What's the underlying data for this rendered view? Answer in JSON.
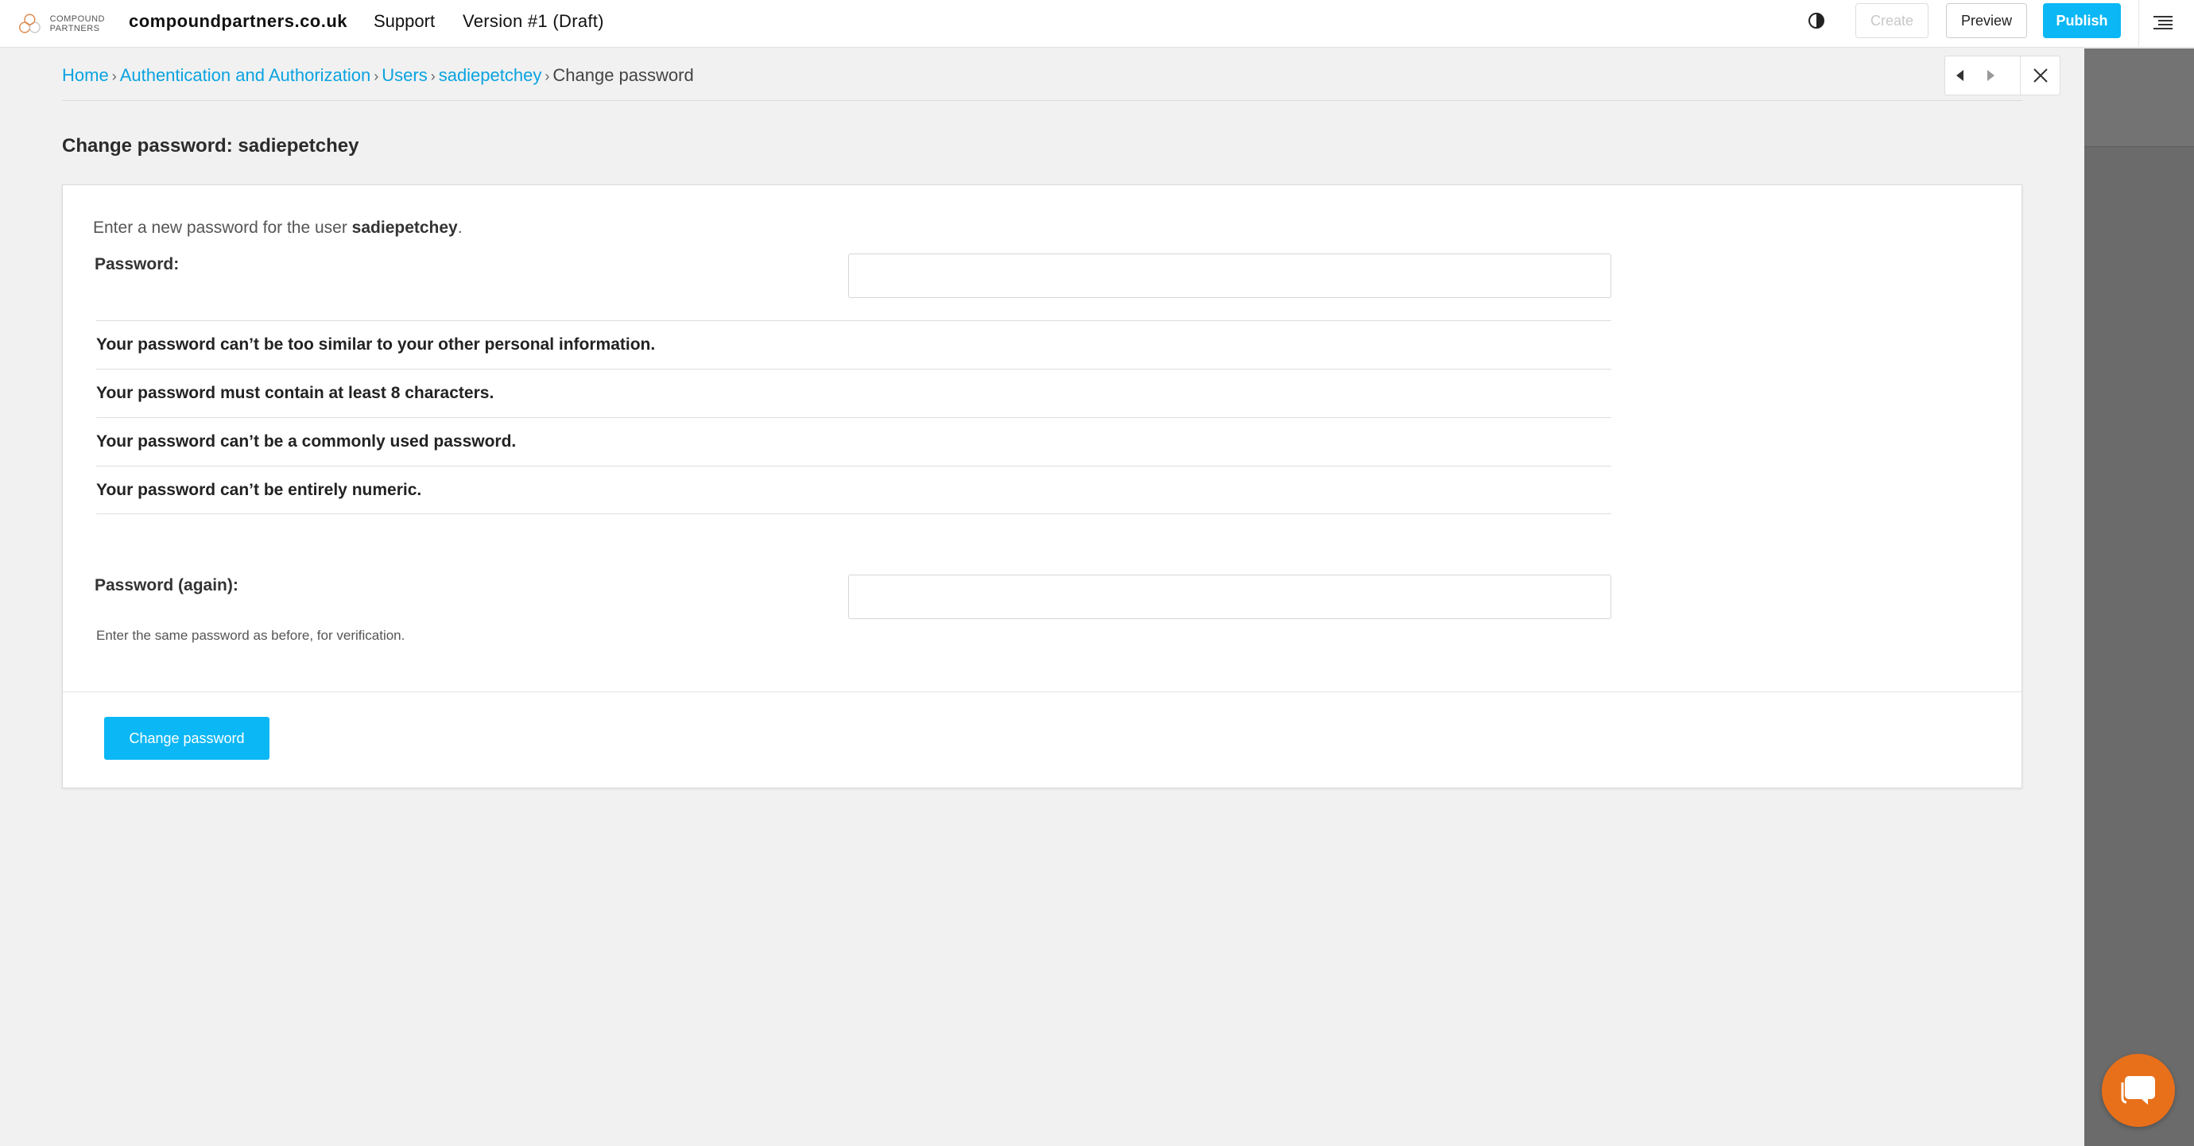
{
  "topbar": {
    "logo_line1": "COMPOUND",
    "logo_line2": "PARTNERS",
    "site_name": "compoundpartners.co.uk",
    "support_label": "Support",
    "version_label": "Version #1 (Draft)",
    "create_label": "Create",
    "preview_label": "Preview",
    "publish_label": "Publish"
  },
  "breadcrumb": {
    "items": [
      "Home",
      "Authentication and Authorization",
      "Users",
      "sadiepetchey"
    ],
    "current": "Change password",
    "separator": "›"
  },
  "page": {
    "title": "Change password: sadiepetchey"
  },
  "form": {
    "intro_prefix": "Enter a new password for the user ",
    "intro_user": "sadiepetchey",
    "intro_suffix": ".",
    "password_label": "Password:",
    "password_value": "",
    "rules": [
      "Your password can’t be too similar to your other personal information.",
      "Your password must contain at least 8 characters.",
      "Your password can’t be a commonly used password.",
      "Your password can’t be entirely numeric."
    ],
    "password_again_label": "Password (again):",
    "password_again_value": "",
    "help_text": "Enter the same password as before, for verification.",
    "submit_label": "Change password"
  },
  "colors": {
    "accent": "#0bb7f5",
    "link": "#0aa3e0",
    "chat_bubble": "#e8701a",
    "side_panel": "#6b6b6b"
  },
  "icons": {
    "contrast": "contrast-icon",
    "menu": "structure-menu-icon",
    "prev": "triangle-left-icon",
    "next": "triangle-right-icon",
    "close": "close-icon",
    "chat": "chat-icon"
  }
}
